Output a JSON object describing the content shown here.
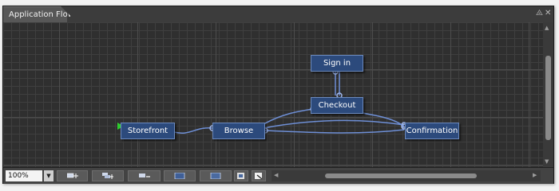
{
  "window": {
    "title": "Application Flow",
    "pin_icon": "pin-icon",
    "close_icon": "close-icon"
  },
  "diagram": {
    "nodes": [
      {
        "key": "storefront",
        "label": "Storefront",
        "start": true
      },
      {
        "key": "browse",
        "label": "Browse"
      },
      {
        "key": "signin",
        "label": "Sign in"
      },
      {
        "key": "checkout",
        "label": "Checkout"
      },
      {
        "key": "confirmation",
        "label": "Confirmation"
      }
    ],
    "edges": [
      {
        "from": "storefront",
        "to": "browse"
      },
      {
        "from": "browse",
        "to": "checkout"
      },
      {
        "from": "browse",
        "to": "confirmation"
      },
      {
        "from": "confirmation",
        "to": "browse"
      },
      {
        "from": "checkout",
        "to": "confirmation"
      },
      {
        "from": "checkout",
        "to": "signin"
      },
      {
        "from": "signin",
        "to": "checkout"
      }
    ],
    "start_marker_color": "#2ecc2e",
    "edge_color": "#6e8fd6"
  },
  "toolbar": {
    "zoom_value": "100%",
    "buttons": [
      {
        "name": "add-node-button",
        "icon": "add-node-icon"
      },
      {
        "name": "add-child-button",
        "icon": "add-child-icon"
      },
      {
        "name": "remove-node-button",
        "icon": "remove-node-icon"
      },
      {
        "name": "layout-button",
        "icon": "layout-icon"
      },
      {
        "name": "fit-view-button",
        "icon": "fit-view-icon"
      },
      {
        "name": "export-button",
        "icon": "export-icon"
      },
      {
        "name": "properties-button",
        "icon": "properties-icon"
      }
    ]
  },
  "colors": {
    "node_fill": "#2c4a7c",
    "node_border": "#6b89bd",
    "canvas_bg": "#2f2f2f"
  }
}
